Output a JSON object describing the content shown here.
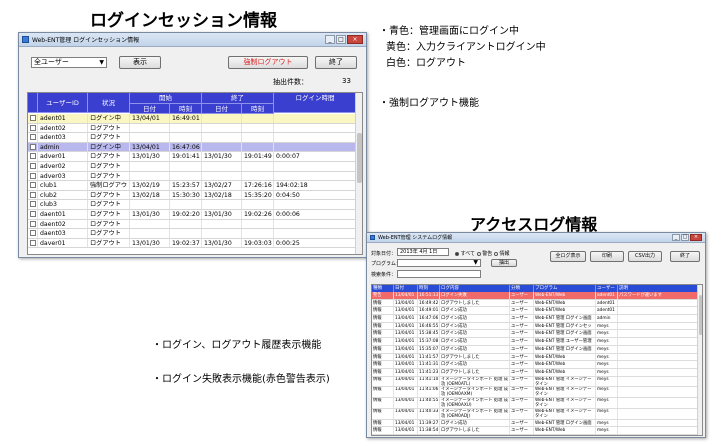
{
  "headings": {
    "login": "ログインセッション情報",
    "access": "アクセスログ情報"
  },
  "notes": {
    "legend": [
      "・青色：管理画面にログイン中",
      "黄色：入力クライアントログイン中",
      "白色：ログアウト"
    ],
    "force_logout": "・強制ログアウト機能",
    "history": "・ログイン、ログアウト履歴表示機能",
    "fail": "・ログイン失敗表示機能(赤色警告表示)"
  },
  "session_window": {
    "title": "Web-ENT管理 ログインセッション情報",
    "filter_value": "全ユーザー",
    "show_button": "表示",
    "force_logout_button": "強制ログアウト",
    "close_button": "終了",
    "count_label": "抽出件数：",
    "count_value": "33",
    "headers": {
      "user_id": "ユーザーID",
      "status": "状況",
      "start": "開始",
      "end": "終了",
      "date": "日付",
      "time": "時刻",
      "duration": "ログイン時間"
    },
    "rows": [
      {
        "user": "adent01",
        "status": "ログイン中",
        "sd": "13/04/01",
        "st": "16:49:01",
        "ed": "",
        "et": "",
        "dur": "",
        "color": "yellow"
      },
      {
        "user": "adent02",
        "status": "ログアウト",
        "sd": "",
        "st": "",
        "ed": "",
        "et": "",
        "dur": "",
        "color": "white"
      },
      {
        "user": "adent03",
        "status": "ログアウト",
        "sd": "",
        "st": "",
        "ed": "",
        "et": "",
        "dur": "",
        "color": "white"
      },
      {
        "user": "admin",
        "status": "ログイン中",
        "sd": "13/04/01",
        "st": "16:47:06",
        "ed": "",
        "et": "",
        "dur": "",
        "color": "blue"
      },
      {
        "user": "adver01",
        "status": "ログアウト",
        "sd": "13/01/30",
        "st": "19:01:41",
        "ed": "13/01/30",
        "et": "19:01:49",
        "dur": "0:00:07",
        "color": "white"
      },
      {
        "user": "adver02",
        "status": "ログアウト",
        "sd": "",
        "st": "",
        "ed": "",
        "et": "",
        "dur": "",
        "color": "white"
      },
      {
        "user": "adver03",
        "status": "ログアウト",
        "sd": "",
        "st": "",
        "ed": "",
        "et": "",
        "dur": "",
        "color": "white"
      },
      {
        "user": "club1",
        "status": "強制ログアウト",
        "sd": "13/02/19",
        "st": "15:23:57",
        "ed": "13/02/27",
        "et": "17:26:16",
        "dur": "194:02:18",
        "color": "white"
      },
      {
        "user": "club2",
        "status": "ログアウト",
        "sd": "13/02/18",
        "st": "15:30:30",
        "ed": "13/02/18",
        "et": "15:35:20",
        "dur": "0:04:50",
        "color": "white"
      },
      {
        "user": "club3",
        "status": "ログアウト",
        "sd": "",
        "st": "",
        "ed": "",
        "et": "",
        "dur": "",
        "color": "white"
      },
      {
        "user": "daent01",
        "status": "ログアウト",
        "sd": "13/01/30",
        "st": "19:02:20",
        "ed": "13/01/30",
        "et": "19:02:26",
        "dur": "0:00:06",
        "color": "white"
      },
      {
        "user": "daent02",
        "status": "ログアウト",
        "sd": "",
        "st": "",
        "ed": "",
        "et": "",
        "dur": "",
        "color": "white"
      },
      {
        "user": "daent03",
        "status": "ログアウト",
        "sd": "",
        "st": "",
        "ed": "",
        "et": "",
        "dur": "",
        "color": "white"
      },
      {
        "user": "daver01",
        "status": "ログアウト",
        "sd": "13/01/30",
        "st": "19:02:37",
        "ed": "13/01/30",
        "et": "19:03:03",
        "dur": "0:00:25",
        "color": "white"
      }
    ]
  },
  "access_window": {
    "title": "Web-ENT管理 システムログ情報",
    "date_label": "対象日付：",
    "date_value": "2013年 4月 1日",
    "radio_all": "すべて",
    "radio_warn": "警告",
    "radio_info": "情報",
    "program_label": "プログラム：",
    "search_label": "検索条件：",
    "extract_button": "抽出",
    "all_display_button": "全ログ表示",
    "print_button": "印刷",
    "csv_button": "CSV出力",
    "close_button": "終了",
    "headers": [
      "種類",
      "日付",
      "時刻",
      "ログ内容",
      "分類",
      "プログラム",
      "ユーザー",
      "説明"
    ],
    "rows": [
      {
        "c": [
          "警告",
          "13/04/01",
          "16:51:13",
          "ログイン失敗",
          "ユーザー",
          "Web-ENT/Web",
          "adent01",
          "パスワードが違います"
        ],
        "warn": true,
        "tall": false
      },
      {
        "c": [
          "情報",
          "13/04/01",
          "16:49:42",
          "ログアウトしました",
          "ユーザー",
          "Web-ENT/Web",
          "adent01",
          ""
        ],
        "warn": false,
        "tall": false
      },
      {
        "c": [
          "情報",
          "13/04/01",
          "16:49:01",
          "ログイン成功",
          "ユーザー",
          "Web-ENT/Web",
          "adent01",
          ""
        ],
        "warn": false,
        "tall": false
      },
      {
        "c": [
          "情報",
          "13/04/01",
          "16:47:06",
          "ログイン成功",
          "ユーザー",
          "Web-ENT 管理 ログイン画面",
          "admin",
          ""
        ],
        "warn": false,
        "tall": false
      },
      {
        "c": [
          "情報",
          "13/04/01",
          "16:46:55",
          "ログイン成功",
          "ユーザー",
          "Web-ENT 管理 ログインセッション情報",
          "meys",
          ""
        ],
        "warn": false,
        "tall": false
      },
      {
        "c": [
          "情報",
          "13/04/01",
          "15:38:45",
          "ログイン成功",
          "ユーザー",
          "Web-ENT 管理 ログイン画面",
          "meys",
          ""
        ],
        "warn": false,
        "tall": false
      },
      {
        "c": [
          "情報",
          "13/04/01",
          "15:37:08",
          "ログイン成功",
          "ユーザー",
          "Web-ENT 管理 ユーザー管理",
          "meys",
          ""
        ],
        "warn": false,
        "tall": false
      },
      {
        "c": [
          "情報",
          "13/04/01",
          "15:35:07",
          "ログイン成功",
          "ユーザー",
          "Web-ENT 管理 ログイン画面",
          "meys",
          ""
        ],
        "warn": false,
        "tall": false
      },
      {
        "c": [
          "情報",
          "13/04/01",
          "11:41:57",
          "ログアウトしました",
          "ユーザー",
          "Web-ENT/Web",
          "meys",
          ""
        ],
        "warn": false,
        "tall": false
      },
      {
        "c": [
          "情報",
          "13/04/01",
          "11:41:31",
          "ログイン成功",
          "ユーザー",
          "Web-ENT/Web",
          "meys",
          ""
        ],
        "warn": false,
        "tall": false
      },
      {
        "c": [
          "情報",
          "13/04/01",
          "11:41:23",
          "ログアウトしました",
          "ユーザー",
          "Web-ENT/Web",
          "meys",
          ""
        ],
        "warn": false,
        "tall": false
      },
      {
        "c": [
          "情報",
          "13/04/01",
          "11:41:10",
          "イメージデータインポート 処理 成功 (OEM0ATL)",
          "ユーザー",
          "Web-ENT 管理 イメージデータイン",
          "meys",
          ""
        ],
        "warn": false,
        "tall": true
      },
      {
        "c": [
          "情報",
          "13/04/01",
          "11:41:06",
          "イメージデータインポート 処理 成功 (OEM0AXM)",
          "ユーザー",
          "Web-ENT 管理 イメージデータイン",
          "meys",
          ""
        ],
        "warn": false,
        "tall": true
      },
      {
        "c": [
          "情報",
          "13/04/01",
          "11:40:55",
          "イメージデータインポート 処理 成功 (OEM0AXU)",
          "ユーザー",
          "Web-ENT 管理 イメージデータイン",
          "meys",
          ""
        ],
        "warn": false,
        "tall": true
      },
      {
        "c": [
          "情報",
          "13/04/01",
          "11:40:33",
          "イメージデータインポート 処理 成功 (OEM0ADJ)",
          "ユーザー",
          "Web-ENT 管理 イメージデータイン",
          "meys",
          ""
        ],
        "warn": false,
        "tall": true
      },
      {
        "c": [
          "情報",
          "13/04/01",
          "11:39:27",
          "ログイン成功",
          "ユーザー",
          "Web-ENT 管理 ログイン画面",
          "meys",
          ""
        ],
        "warn": false,
        "tall": false
      },
      {
        "c": [
          "情報",
          "13/04/01",
          "11:38:54",
          "ログアウトしました",
          "ユーザー",
          "Web-ENT/Web",
          "meys",
          ""
        ],
        "warn": false,
        "tall": false
      },
      {
        "c": [
          "情報",
          "13/04/01",
          "11:38:43",
          "ログイン成功",
          "ユーザー",
          "Web-ENT/Web",
          "meys",
          ""
        ],
        "warn": false,
        "tall": false
      }
    ]
  }
}
